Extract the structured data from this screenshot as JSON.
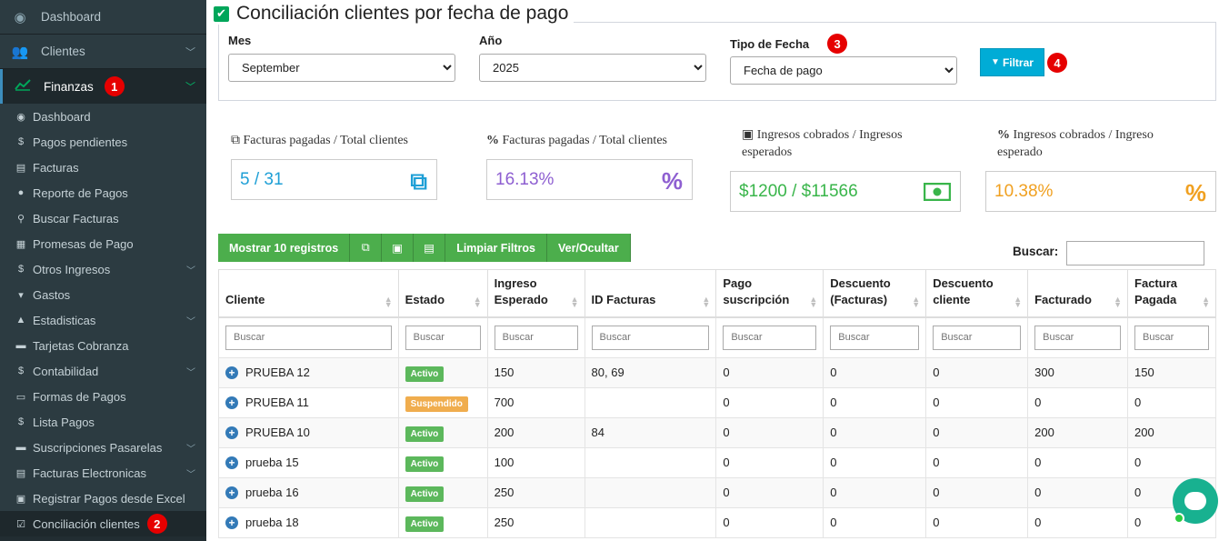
{
  "sidebar": {
    "top_items": [
      {
        "label": "Dashboard",
        "icon": "dashboard-icon"
      },
      {
        "label": "Clientes",
        "icon": "users-icon"
      }
    ],
    "active": {
      "label": "Finanzas",
      "badge": "1",
      "icon": "line-chart-icon"
    },
    "sub_items": [
      {
        "label": "Dashboard",
        "glyph": "◉",
        "chev": false
      },
      {
        "label": "Pagos pendientes",
        "glyph": "$",
        "chev": false
      },
      {
        "label": "Facturas",
        "glyph": "▤",
        "chev": false
      },
      {
        "label": "Reporte de Pagos",
        "glyph": "●",
        "chev": false
      },
      {
        "label": "Buscar Facturas",
        "glyph": "⚲",
        "chev": false
      },
      {
        "label": "Promesas de Pago",
        "glyph": "▦",
        "chev": false
      },
      {
        "label": "Otros Ingresos",
        "glyph": "$",
        "chev": true
      },
      {
        "label": "Gastos",
        "glyph": "▾",
        "chev": false
      },
      {
        "label": "Estadisticas",
        "glyph": "▲",
        "chev": true
      },
      {
        "label": "Tarjetas Cobranza",
        "glyph": "▬",
        "chev": false
      },
      {
        "label": "Contabilidad",
        "glyph": "$",
        "chev": true
      },
      {
        "label": "Formas de Pagos",
        "glyph": "▭",
        "chev": false
      },
      {
        "label": "Lista Pagos",
        "glyph": "$",
        "chev": false
      },
      {
        "label": "Suscripciones Pasarelas",
        "glyph": "▬",
        "chev": true
      },
      {
        "label": "Facturas Electronicas",
        "glyph": "▤",
        "chev": true
      },
      {
        "label": "Registrar Pagos desde Excel",
        "glyph": "▣",
        "chev": false
      }
    ],
    "last_item": {
      "label": "Conciliación clientes",
      "badge": "2"
    }
  },
  "page": {
    "title": "Conciliación clientes por fecha de pago"
  },
  "filters": {
    "mes": {
      "label": "Mes",
      "value": "September"
    },
    "anio": {
      "label": "Año",
      "value": "2025"
    },
    "tipo": {
      "label": "Tipo de Fecha",
      "value": "Fecha de pago",
      "badge": "3"
    },
    "button": {
      "label": "Filtrar",
      "badge": "4"
    }
  },
  "stats": [
    {
      "label": "Facturas pagadas / Total clientes",
      "value": "5 / 31",
      "color": "#1e9fd6"
    },
    {
      "label": "Facturas pagadas / Total clientes",
      "value": "16.13%",
      "color": "#8e5fd1"
    },
    {
      "label": "Ingresos cobrados / Ingresos esperados",
      "value": "$1200 / $11566",
      "color": "#39b54a"
    },
    {
      "label": "Ingresos cobrados / Ingreso esperado",
      "value": "10.38%",
      "color": "#f0a020"
    }
  ],
  "toolbar": {
    "show": "Mostrar 10 registros",
    "clear": "Limpiar Filtros",
    "toggle": "Ver/Ocultar"
  },
  "search": {
    "label": "Buscar:"
  },
  "table": {
    "columns": [
      "Cliente",
      "Estado",
      "Ingreso Esperado",
      "ID Facturas",
      "Pago suscripción",
      "Descuento (Facturas)",
      "Descuento cliente",
      "Facturado",
      "Factura Pagada"
    ],
    "filter_placeholder": "Buscar",
    "rows": [
      {
        "cliente": "PRUEBA 12",
        "estado": "Activo",
        "ingreso": "150",
        "ids": "80, 69",
        "pago": "0",
        "desc_f": "0",
        "desc_c": "0",
        "facturado": "300",
        "pagada": "150"
      },
      {
        "cliente": "PRUEBA 11",
        "estado": "Suspendido",
        "ingreso": "700",
        "ids": "",
        "pago": "0",
        "desc_f": "0",
        "desc_c": "0",
        "facturado": "0",
        "pagada": "0"
      },
      {
        "cliente": "PRUEBA 10",
        "estado": "Activo",
        "ingreso": "200",
        "ids": "84",
        "pago": "0",
        "desc_f": "0",
        "desc_c": "0",
        "facturado": "200",
        "pagada": "200"
      },
      {
        "cliente": "prueba 15",
        "estado": "Activo",
        "ingreso": "100",
        "ids": "",
        "pago": "0",
        "desc_f": "0",
        "desc_c": "0",
        "facturado": "0",
        "pagada": "0"
      },
      {
        "cliente": "prueba 16",
        "estado": "Activo",
        "ingreso": "250",
        "ids": "",
        "pago": "0",
        "desc_f": "0",
        "desc_c": "0",
        "facturado": "0",
        "pagada": "0"
      },
      {
        "cliente": "prueba 18",
        "estado": "Activo",
        "ingreso": "250",
        "ids": "",
        "pago": "0",
        "desc_f": "0",
        "desc_c": "0",
        "facturado": "0",
        "pagada": "0"
      }
    ]
  }
}
